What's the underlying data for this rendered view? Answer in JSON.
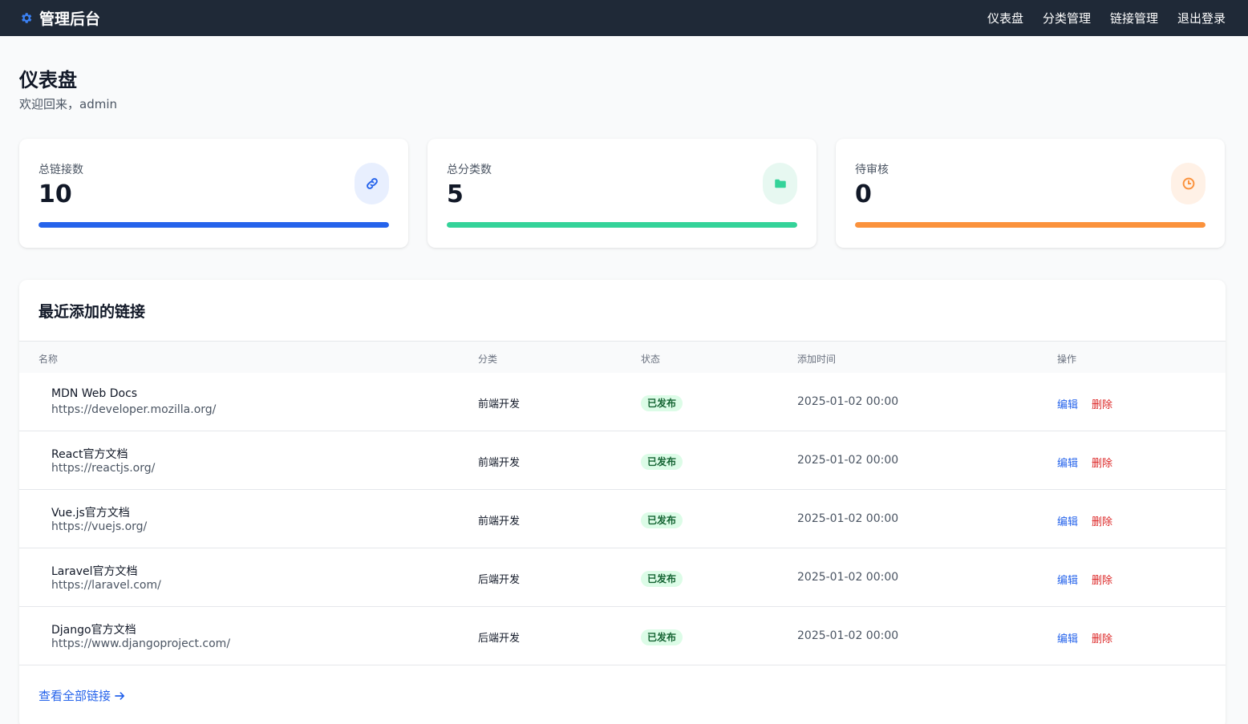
{
  "header": {
    "brand": "管理后台",
    "nav": [
      "仪表盘",
      "分类管理",
      "链接管理",
      "退出登录"
    ]
  },
  "page": {
    "title": "仪表盘",
    "welcome": "欢迎回来，admin"
  },
  "stats": [
    {
      "label": "总链接数",
      "value": "10",
      "icon": "link-icon",
      "accent": "#2563eb",
      "icon_bg": "#e8effe"
    },
    {
      "label": "总分类数",
      "value": "5",
      "icon": "folder-icon",
      "accent": "#34d399",
      "icon_bg": "#e7f8f1"
    },
    {
      "label": "待审核",
      "value": "0",
      "icon": "clock-icon",
      "accent": "#fb923c",
      "icon_bg": "#fff1e6"
    }
  ],
  "recent": {
    "title": "最近添加的链接",
    "columns": [
      "名称",
      "分类",
      "状态",
      "添加时间",
      "操作"
    ],
    "rows": [
      {
        "name": "MDN Web Docs",
        "url": "https://developer.mozilla.org/",
        "category": "前端开发",
        "status": "已发布",
        "time": "2025-01-02 00:00",
        "edit": "编辑",
        "delete": "删除"
      },
      {
        "name": "React官方文档",
        "url": "https://reactjs.org/",
        "category": "前端开发",
        "status": "已发布",
        "time": "2025-01-02 00:00",
        "edit": "编辑",
        "delete": "删除"
      },
      {
        "name": "Vue.js官方文档",
        "url": "https://vuejs.org/",
        "category": "前端开发",
        "status": "已发布",
        "time": "2025-01-02 00:00",
        "edit": "编辑",
        "delete": "删除"
      },
      {
        "name": "Laravel官方文档",
        "url": "https://laravel.com/",
        "category": "后端开发",
        "status": "已发布",
        "time": "2025-01-02 00:00",
        "edit": "编辑",
        "delete": "删除"
      },
      {
        "name": "Django官方文档",
        "url": "https://www.djangoproject.com/",
        "category": "后端开发",
        "status": "已发布",
        "time": "2025-01-02 00:00",
        "edit": "编辑",
        "delete": "删除"
      }
    ],
    "view_all": "查看全部链接"
  }
}
